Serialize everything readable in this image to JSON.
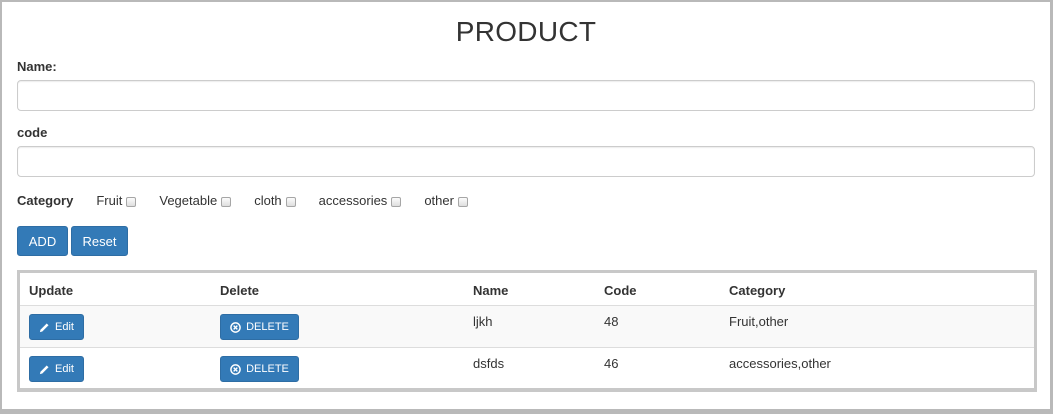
{
  "page": {
    "title": "PRODUCT"
  },
  "form": {
    "name_label": "Name:",
    "name_value": "",
    "code_label": "code",
    "code_value": "",
    "category_label": "Category",
    "categories": [
      {
        "label": "Fruit",
        "checked": false
      },
      {
        "label": "Vegetable",
        "checked": false
      },
      {
        "label": "cloth",
        "checked": false
      },
      {
        "label": "accessories",
        "checked": false
      },
      {
        "label": "other",
        "checked": false
      }
    ],
    "add_label": "ADD",
    "reset_label": "Reset"
  },
  "table": {
    "headers": [
      "Update",
      "Delete",
      "Name",
      "Code",
      "Category"
    ],
    "rows": [
      {
        "edit_label": "Edit",
        "delete_label": "DELETE",
        "name": "ljkh",
        "code": "48",
        "category": "Fruit,other"
      },
      {
        "edit_label": "Edit",
        "delete_label": "DELETE",
        "name": "dsfds",
        "code": "46",
        "category": "accessories,other"
      }
    ]
  },
  "icons": {
    "edit": "pencil-icon",
    "delete": "remove-circle-icon"
  },
  "colors": {
    "primary": "#337ab7",
    "primary_border": "#2e6da4",
    "stripe": "#f9f9f9",
    "text": "#333333"
  }
}
